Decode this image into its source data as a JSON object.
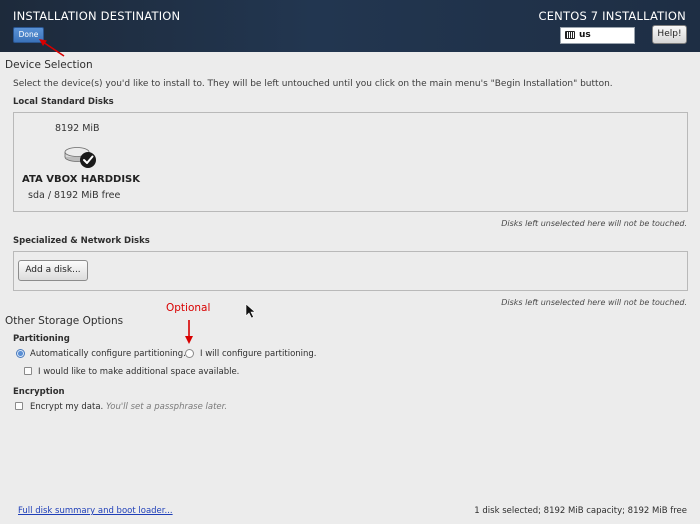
{
  "header": {
    "title": "INSTALLATION DESTINATION",
    "product": "CENTOS 7 INSTALLATION",
    "done_label": "Done",
    "keyboard_layout": "us",
    "help_label": "Help!"
  },
  "device_selection": {
    "heading": "Device Selection",
    "description": "Select the device(s) you'd like to install to.  They will be left untouched until you click on the main menu's \"Begin Installation\" button.",
    "local_heading": "Local Standard Disks",
    "disk": {
      "size": "8192 MiB",
      "name": "ATA VBOX HARDDISK",
      "info": "sda  /  8192 MiB free",
      "selected": true
    },
    "local_hint": "Disks left unselected here will not be touched.",
    "network_heading": "Specialized & Network Disks",
    "add_disk_label": "Add a disk...",
    "network_hint": "Disks left unselected here will not be touched."
  },
  "other_storage": {
    "heading": "Other Storage Options",
    "partitioning_heading": "Partitioning",
    "auto_label": "Automatically configure partitioning.",
    "manual_label": "I will configure partitioning.",
    "space_label": "I would like to make additional space available.",
    "encryption_heading": "Encryption",
    "encrypt_label": "Encrypt my data.",
    "encrypt_note": "You'll set a passphrase later.",
    "selected_option": "auto"
  },
  "annotation": {
    "optional_label": "Optional",
    "color": "#d80000"
  },
  "footer": {
    "summary_link": "Full disk summary and boot loader...",
    "status": "1 disk selected; 8192 MiB capacity; 8192 MiB free"
  },
  "colors": {
    "header_bg": "#1e2e44",
    "done_button": "#3b73ba",
    "link": "#1f3fb8"
  }
}
